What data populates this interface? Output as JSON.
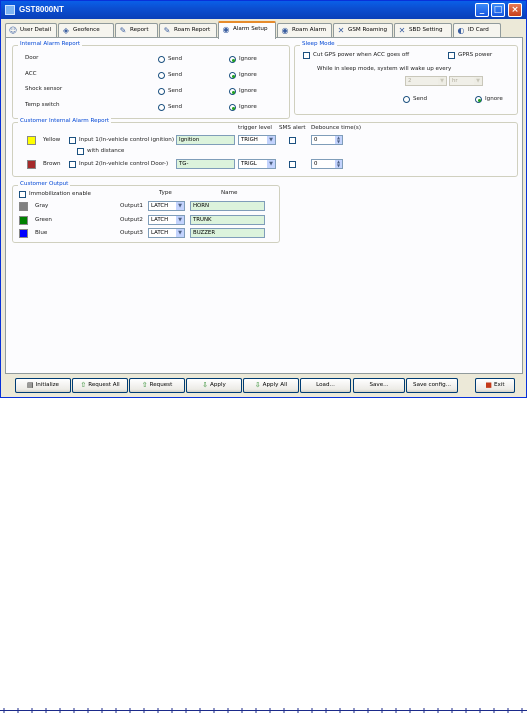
{
  "window": {
    "title": "GST8000NT"
  },
  "tabs": [
    {
      "label": "User Detail",
      "icon": "user-icon"
    },
    {
      "label": "Geofence",
      "icon": "geofence-icon"
    },
    {
      "label": "Report",
      "icon": "report-icon"
    },
    {
      "label": "Roam Report",
      "icon": "roam-report-icon"
    },
    {
      "label": "Alarm Setup",
      "icon": "alarm-icon",
      "active": true
    },
    {
      "label": "Roam Alarm",
      "icon": "roam-alarm-icon"
    },
    {
      "label": "GSM Roaming",
      "icon": "gsm-icon"
    },
    {
      "label": "SBD Setting",
      "icon": "sbd-icon"
    },
    {
      "label": "ID Card",
      "icon": "id-card-icon"
    }
  ],
  "internal_alarm": {
    "legend": "Internal Alarm Report",
    "rows": [
      {
        "label": "Door",
        "send": "Send",
        "ignore": "Ignore",
        "selected": "ignore"
      },
      {
        "label": "ACC",
        "send": "Send",
        "ignore": "Ignore",
        "selected": "ignore"
      },
      {
        "label": "Shock sensor",
        "send": "Send",
        "ignore": "Ignore",
        "selected": "ignore"
      },
      {
        "label": "Temp switch",
        "send": "Send",
        "ignore": "Ignore",
        "selected": "ignore"
      }
    ]
  },
  "sleep_mode": {
    "legend": "Sleep Mode",
    "cut_gps": "Cut GPS power when ACC goes off",
    "gprs_power": "GPRS power",
    "wake_text": "While in sleep mode, system will wake up every",
    "wake_value": "2",
    "wake_unit": "hr",
    "send": "Send",
    "ignore": "Ignore",
    "selected": "ignore"
  },
  "customer_alarm": {
    "legend": "Customer Internal Alarm Report",
    "col_trigger": "trigger level",
    "col_sms": "SMS alert",
    "col_debounce": "Debounce time(s)",
    "rows": [
      {
        "color_name": "Yellow",
        "color": "#ffff00",
        "input_label": "Input 1(In-vehicle control ignition)",
        "name": "Ignition",
        "trigger": "TRIGH",
        "debounce": "0",
        "extra": "with distance"
      },
      {
        "color_name": "Brown",
        "color": "#a52a2a",
        "input_label": "Input 2(In-vehicle control Door-)",
        "name": "TG-",
        "trigger": "TRIGL",
        "debounce": "0"
      }
    ]
  },
  "customer_output": {
    "legend": "Customer Output",
    "immobilization": "Immobilization enable",
    "col_type": "Type",
    "col_name": "Name",
    "rows": [
      {
        "color_name": "Gray",
        "color": "#808080",
        "output": "Output1",
        "type": "LATCH",
        "name": "HORN"
      },
      {
        "color_name": "Green",
        "color": "#008000",
        "output": "Output2",
        "type": "LATCH",
        "name": "TRUNK"
      },
      {
        "color_name": "Blue",
        "color": "#0000ff",
        "output": "Output3",
        "type": "LATCH",
        "name": "BUZZER"
      }
    ]
  },
  "buttons": [
    {
      "label": "Initialize",
      "icon": "initialize-icon"
    },
    {
      "label": "Request All",
      "icon": "request-all-icon"
    },
    {
      "label": "Request",
      "icon": "request-icon"
    },
    {
      "label": "Apply",
      "icon": "apply-icon"
    },
    {
      "label": "Apply All",
      "icon": "apply-all-icon"
    },
    {
      "label": "Load..."
    },
    {
      "label": "Save..."
    },
    {
      "label": "Save config..."
    },
    {
      "label": "Exit",
      "icon": "exit-icon"
    }
  ]
}
